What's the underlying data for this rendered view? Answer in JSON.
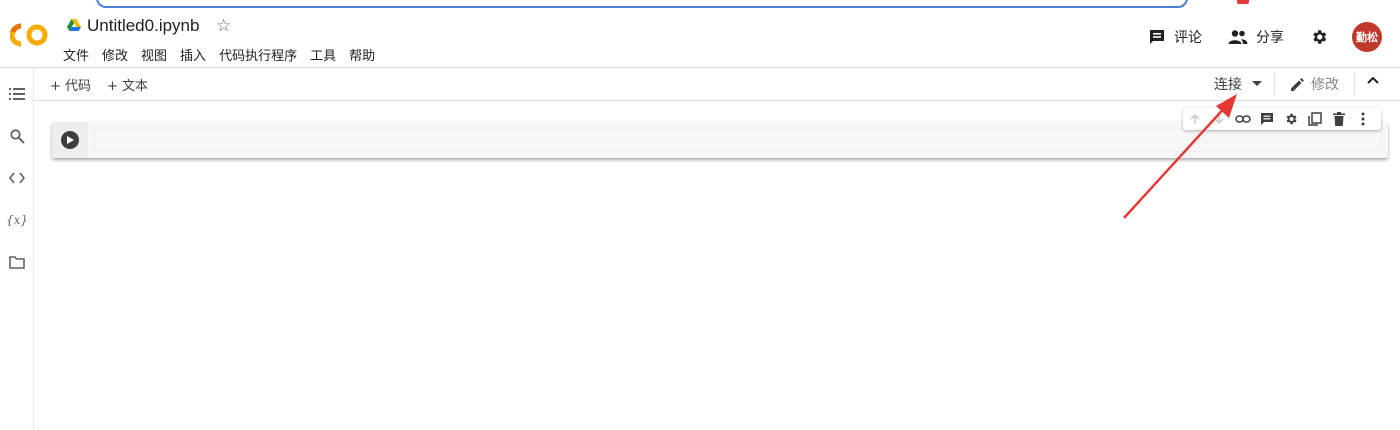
{
  "header": {
    "title": "Untitled0.ipynb",
    "star_glyph": "☆",
    "menu": [
      "文件",
      "修改",
      "视图",
      "插入",
      "代码执行程序",
      "工具",
      "帮助"
    ],
    "comment_label": "评论",
    "share_label": "分享",
    "avatar_text": "勤松"
  },
  "toolbar": {
    "add_code_label": "+ 代码",
    "add_text_label": "+ 文本",
    "connect_label": "连接",
    "edit_label": "修改"
  },
  "colors": {
    "accent_orange": "#f9ab00",
    "avatar_bg": "#c0392b",
    "arrow": "#e53935"
  },
  "rail_icons": [
    "toc-icon",
    "search-icon",
    "code-snippets-icon",
    "variables-icon",
    "folder-icon"
  ],
  "variables_glyph": "{x}",
  "cell_toolbar_icons": [
    "move-up-icon",
    "move-down-icon",
    "link-icon",
    "comment-icon",
    "settings-icon",
    "mirror-cell-icon",
    "delete-icon",
    "more-icon"
  ]
}
